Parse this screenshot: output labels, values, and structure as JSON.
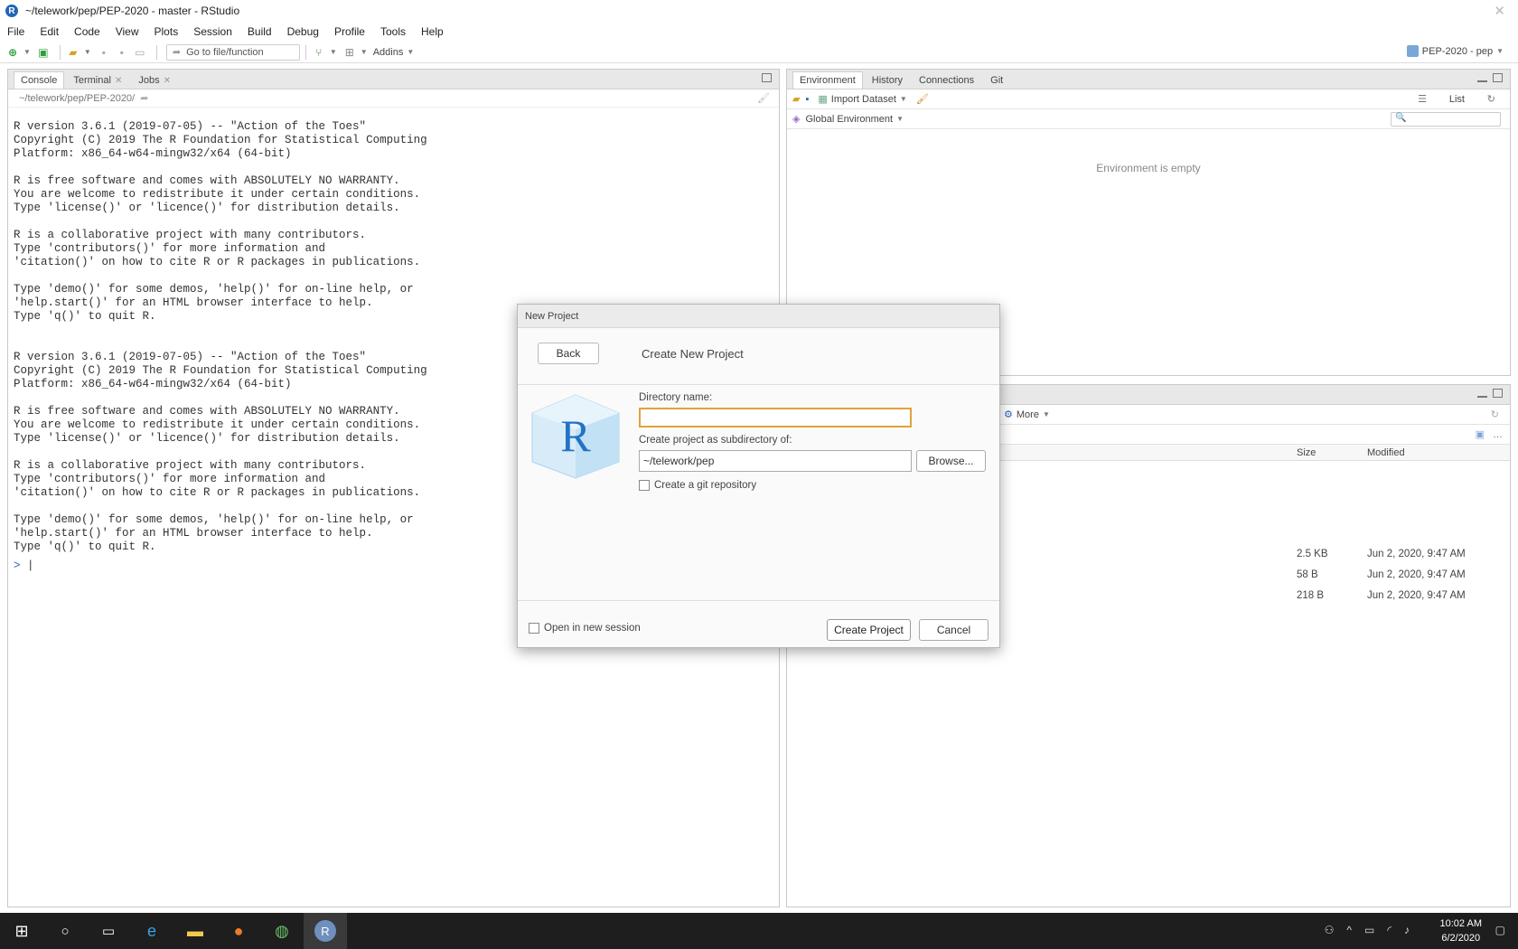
{
  "window": {
    "title": "~/telework/pep/PEP-2020 - master - RStudio",
    "app_icon_letter": "R"
  },
  "menu": [
    "File",
    "Edit",
    "Code",
    "View",
    "Plots",
    "Session",
    "Build",
    "Debug",
    "Profile",
    "Tools",
    "Help"
  ],
  "toolbar": {
    "goto_placeholder": "Go to file/function",
    "addins_label": "Addins",
    "project_label": "PEP-2020 - pep"
  },
  "console_pane": {
    "tabs": [
      {
        "label": "Console"
      },
      {
        "label": "Terminal"
      },
      {
        "label": "Jobs"
      }
    ],
    "path": "~/telework/pep/PEP-2020/",
    "output": "R version 3.6.1 (2019-07-05) -- \"Action of the Toes\"\nCopyright (C) 2019 The R Foundation for Statistical Computing\nPlatform: x86_64-w64-mingw32/x64 (64-bit)\n\nR is free software and comes with ABSOLUTELY NO WARRANTY.\nYou are welcome to redistribute it under certain conditions.\nType 'license()' or 'licence()' for distribution details.\n\nR is a collaborative project with many contributors.\nType 'contributors()' for more information and\n'citation()' on how to cite R or R packages in publications.\n\nType 'demo()' for some demos, 'help()' for on-line help, or\n'help.start()' for an HTML browser interface to help.\nType 'q()' to quit R.\n\n\nR version 3.6.1 (2019-07-05) -- \"Action of the Toes\"\nCopyright (C) 2019 The R Foundation for Statistical Computing\nPlatform: x86_64-w64-mingw32/x64 (64-bit)\n\nR is free software and comes with ABSOLUTELY NO WARRANTY.\nYou are welcome to redistribute it under certain conditions.\nType 'license()' or 'licence()' for distribution details.\n\nR is a collaborative project with many contributors.\nType 'contributors()' for more information and\n'citation()' on how to cite R or R packages in publications.\n\nType 'demo()' for some demos, 'help()' for on-line help, or\n'help.start()' for an HTML browser interface to help.\nType 'q()' to quit R.",
    "prompt": ">"
  },
  "env_pane": {
    "tabs": [
      {
        "label": "Environment"
      },
      {
        "label": "History"
      },
      {
        "label": "Connections"
      },
      {
        "label": "Git"
      }
    ],
    "import_label": "Import Dataset",
    "list_label": "List",
    "scope_label": "Global Environment",
    "empty_text": "Environment is empty"
  },
  "files_pane": {
    "more_label": "More",
    "columns": {
      "size": "Size",
      "modified": "Modified"
    },
    "rows": [
      {
        "size": "2.5 KB",
        "modified": "Jun 2, 2020, 9:47 AM"
      },
      {
        "size": "58 B",
        "modified": "Jun 2, 2020, 9:47 AM"
      },
      {
        "size": "218 B",
        "modified": "Jun 2, 2020, 9:47 AM"
      }
    ]
  },
  "dialog": {
    "title": "New Project",
    "back_label": "Back",
    "heading": "Create New Project",
    "dir_name_label": "Directory name:",
    "dir_name_value": "",
    "parent_label": "Create project as subdirectory of:",
    "parent_value": "~/telework/pep",
    "browse_label": "Browse...",
    "git_label": "Create a git repository",
    "new_session_label": "Open in new session",
    "create_label": "Create Project",
    "cancel_label": "Cancel",
    "logo_letter": "R"
  },
  "taskbar": {
    "time": "10:02 AM",
    "date": "6/2/2020"
  },
  "colors": {
    "accent": "#2165b6",
    "focus": "#e0a43a"
  }
}
